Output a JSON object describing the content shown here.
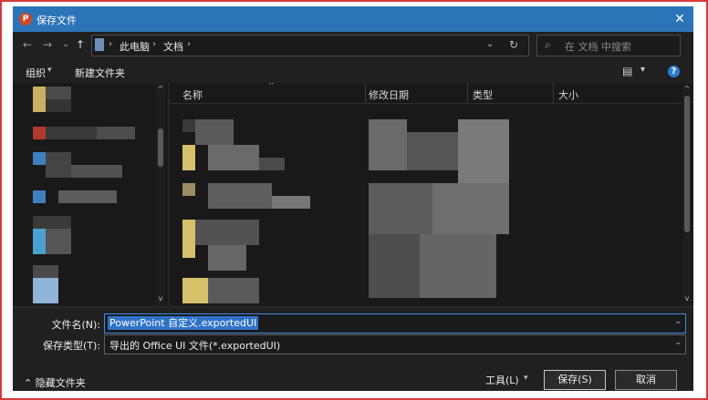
{
  "window": {
    "title": "保存文件",
    "app_icon": "P",
    "close_glyph": "✕"
  },
  "nav": {
    "back_glyph": "←",
    "forward_glyph": "→",
    "recent_glyph": "⌄",
    "up_glyph": "↑",
    "path": [
      "此电脑",
      "文档"
    ],
    "path_sep": "›",
    "address_dropdown": "⌄",
    "refresh_glyph": "↻",
    "search_placeholder": "在 文档 中搜索",
    "search_glyph": "⌕"
  },
  "toolbar": {
    "organize_label": "组织",
    "organize_caret": "▾",
    "new_folder_label": "新建文件夹",
    "view_glyph": "▤",
    "view_caret": "▾",
    "help_glyph": "?"
  },
  "file_list": {
    "columns": [
      "名称",
      "修改日期",
      "类型",
      "大小"
    ],
    "sort_caret": "^"
  },
  "footer": {
    "filename_label": "文件名(N):",
    "filename_value": "PowerPoint 自定义.exportedUI",
    "filetype_label": "保存类型(T):",
    "filetype_value": "导出的 Office UI 文件(*.exportedUI)",
    "dropdown_glyph": "⌄",
    "hide_folders_label": "隐藏文件夹",
    "hide_caret": "⌃",
    "tools_label": "工具(L)",
    "tools_caret": "▾",
    "save_label": "保存(S)",
    "cancel_label": "取消"
  },
  "colors": {
    "titlebar": "#2c74b8",
    "background": "#202020",
    "selection": "#2e73c8",
    "frame_border": "#d63a3a"
  }
}
